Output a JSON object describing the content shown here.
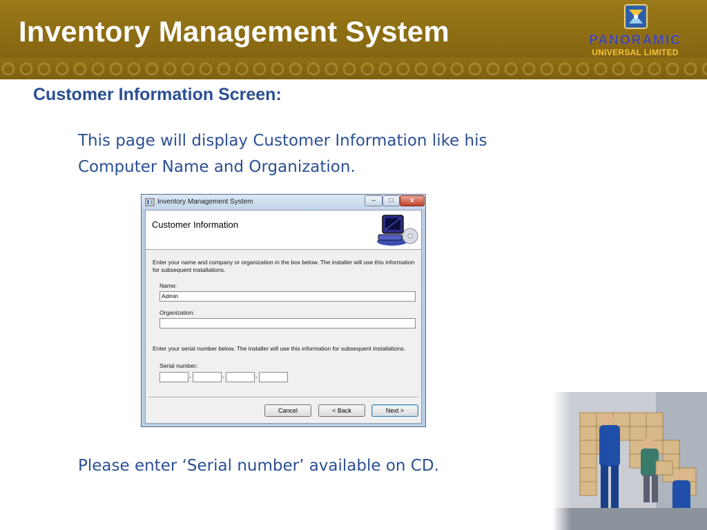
{
  "header": {
    "title": "Inventory Management System",
    "logo_line1": "PANORAMIC",
    "logo_line2": "UNIVERSAL LIMITED"
  },
  "slide": {
    "heading": "Customer Information Screen:",
    "description": "This page will display Customer Information like his Computer Name and Organization.",
    "note": "Please enter ‘Serial number’ available on CD."
  },
  "window": {
    "title": "Inventory Management System",
    "controls": {
      "minimize": "–",
      "maximize": "□",
      "close": "x"
    },
    "header_title": "Customer Information",
    "intro_text": "Enter your name and company or organization in the box below. The installer will use this information for subsequent installations.",
    "name_label": "Name:",
    "name_value": "Admin",
    "organization_label": "Organization:",
    "organization_value": "",
    "serial_intro": "Enter your serial number below. The installer will use this information for subsequent installations.",
    "serial_label": "Serial number:",
    "serial_separator": "-",
    "buttons": {
      "cancel": "Cancel",
      "back": "< Back",
      "next": "Next >"
    }
  },
  "icons": [
    "installer-app-icon",
    "computer-disk-icon",
    "logo-emblem-icon"
  ],
  "colors": {
    "banner": "#8a6a12",
    "heading_text": "#2a4f93",
    "window_frame": "#b9cde3"
  }
}
